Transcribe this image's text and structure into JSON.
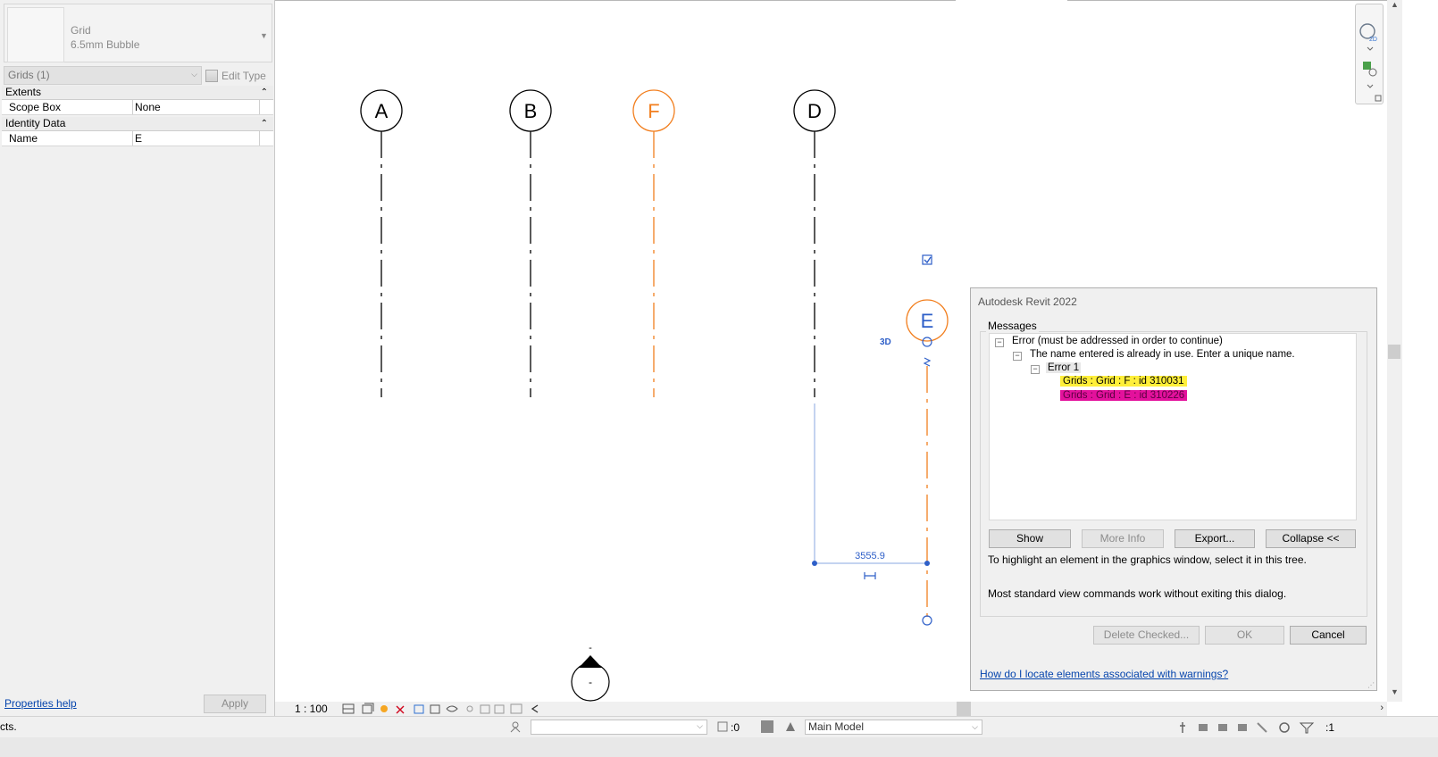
{
  "properties": {
    "type_name": "Grid",
    "type_sub": "6.5mm Bubble",
    "filter": "Grids (1)",
    "edit_type": "Edit Type",
    "groups": [
      {
        "label": "Extents",
        "rows": [
          {
            "key": "Scope Box",
            "value": "None"
          }
        ]
      },
      {
        "label": "Identity Data",
        "rows": [
          {
            "key": "Name",
            "value": "E"
          }
        ]
      }
    ],
    "help_link": "Properties help",
    "apply": "Apply"
  },
  "canvas": {
    "grids": [
      "A",
      "B",
      "F",
      "D"
    ],
    "selected_grid": "E",
    "dimension_value": "3555.9",
    "label_3d": "3D",
    "section_mark": "-",
    "section_mark_top": "-",
    "highlight_color": "#f27f1f",
    "select_color": "#2e5fc8"
  },
  "view_bar": {
    "scale": "1 : 100"
  },
  "status_bar": {
    "left_text": "cts.",
    "count": ":0",
    "model": "Main Model",
    "filter_count": ":1"
  },
  "dialog": {
    "title": "Autodesk Revit 2022",
    "group_label": "Messages",
    "tree": {
      "error": "Error (must be addressed in order to continue)",
      "message": "The name entered is already in use. Enter a unique name.",
      "error_item": "Error 1",
      "elements": [
        "Grids : Grid : F : id 310031",
        "Grids : Grid : E : id 310226"
      ]
    },
    "buttons": {
      "show": "Show",
      "more_info": "More Info",
      "export": "Export...",
      "collapse": "Collapse <<"
    },
    "hint1": "To highlight an element in the graphics window, select it in this tree.",
    "hint2": "Most standard view commands work without exiting this dialog.",
    "delete_checked": "Delete Checked...",
    "ok": "OK",
    "cancel": "Cancel",
    "help_link": "How do I locate elements associated with warnings?"
  }
}
